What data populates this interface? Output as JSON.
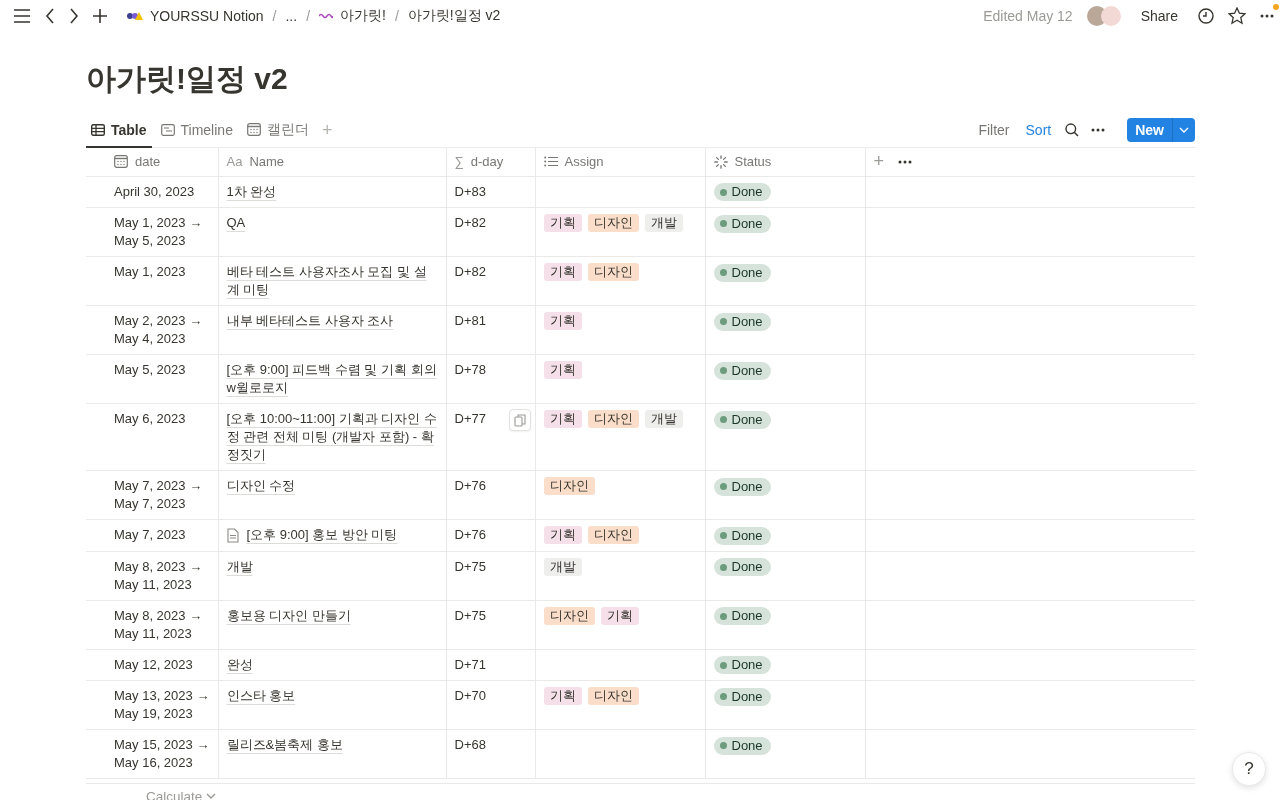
{
  "breadcrumbs": [
    {
      "kind": "link",
      "label": "YOURSSU Notion"
    },
    {
      "kind": "sep",
      "label": "/"
    },
    {
      "kind": "link",
      "label": "..."
    },
    {
      "kind": "sep",
      "label": "/"
    },
    {
      "kind": "link",
      "label": "아가릿!"
    },
    {
      "kind": "sep",
      "label": "/"
    },
    {
      "kind": "link",
      "label": "아가릿!일정 v2"
    }
  ],
  "edited": "Edited May 12",
  "share": "Share",
  "has_notification": true,
  "title": "아가릿!일정 v2",
  "views": [
    {
      "label": "Table",
      "selected": true
    },
    {
      "label": "Timeline",
      "selected": false
    },
    {
      "label": "캘린더",
      "selected": false
    }
  ],
  "add_view": "+",
  "toolbar": [
    {
      "label": "Filter",
      "active": false
    },
    {
      "label": "Sort",
      "active": true
    }
  ],
  "new_button": "New",
  "columns": [
    {
      "label": "date"
    },
    {
      "label": "Name",
      "glyph": "Aa"
    },
    {
      "label": "d-day",
      "glyph": "∑"
    },
    {
      "label": "Assign"
    },
    {
      "label": "Status"
    }
  ],
  "add_column": "+",
  "rows": [
    {
      "date": [
        "April 30, 2023"
      ],
      "name": "1차 완성",
      "page_icon": false,
      "dday": "D+83",
      "copy_button": false,
      "assign": [],
      "status": {
        "label": "Done",
        "color": "#6c9b7d"
      }
    },
    {
      "date": [
        "May 1, 2023 →",
        "May 5, 2023"
      ],
      "name": "QA",
      "page_icon": false,
      "dday": "D+82",
      "copy_button": false,
      "assign": [
        {
          "label": "기획",
          "color": "#f5e0e9"
        },
        {
          "label": "디자인",
          "color": "#fadec9"
        },
        {
          "label": "개발",
          "color": "#eeeeec"
        }
      ],
      "status": {
        "label": "Done",
        "color": "#6c9b7d"
      }
    },
    {
      "date": [
        "May 1, 2023"
      ],
      "name": "베타 테스트 사용자조사 모집 및 설계 미팅",
      "page_icon": false,
      "dday": "D+82",
      "copy_button": false,
      "assign": [
        {
          "label": "기획",
          "color": "#f5e0e9"
        },
        {
          "label": "디자인",
          "color": "#fadec9"
        }
      ],
      "status": {
        "label": "Done",
        "color": "#6c9b7d"
      }
    },
    {
      "date": [
        "May 2, 2023 →",
        "May 4, 2023"
      ],
      "name": "내부 베타테스트 사용자 조사",
      "page_icon": false,
      "dday": "D+81",
      "copy_button": false,
      "assign": [
        {
          "label": "기획",
          "color": "#f5e0e9"
        }
      ],
      "status": {
        "label": "Done",
        "color": "#6c9b7d"
      }
    },
    {
      "date": [
        "May 5, 2023"
      ],
      "name": "[오후 9:00] 피드백 수렴 및 기획 회의 w윌로로지",
      "page_icon": false,
      "dday": "D+78",
      "copy_button": false,
      "assign": [
        {
          "label": "기획",
          "color": "#f5e0e9"
        }
      ],
      "status": {
        "label": "Done",
        "color": "#6c9b7d"
      }
    },
    {
      "date": [
        "May 6, 2023"
      ],
      "name": "[오후 10:00~11:00] 기획과 디자인 수정 관련 전체 미팅 (개발자 포함) - 확정짓기",
      "page_icon": false,
      "dday": "D+77",
      "copy_button": true,
      "assign": [
        {
          "label": "기획",
          "color": "#f5e0e9"
        },
        {
          "label": "디자인",
          "color": "#fadec9"
        },
        {
          "label": "개발",
          "color": "#eeeeec"
        }
      ],
      "status": {
        "label": "Done",
        "color": "#6c9b7d"
      }
    },
    {
      "date": [
        "May 7, 2023 →",
        "May 7, 2023"
      ],
      "name": "디자인 수정",
      "page_icon": false,
      "dday": "D+76",
      "copy_button": false,
      "assign": [
        {
          "label": "디자인",
          "color": "#fadec9"
        }
      ],
      "status": {
        "label": "Done",
        "color": "#6c9b7d"
      }
    },
    {
      "date": [
        "May 7, 2023"
      ],
      "name": "[오후 9:00] 홍보 방안 미팅",
      "page_icon": true,
      "dday": "D+76",
      "copy_button": false,
      "assign": [
        {
          "label": "기획",
          "color": "#f5e0e9"
        },
        {
          "label": "디자인",
          "color": "#fadec9"
        }
      ],
      "status": {
        "label": "Done",
        "color": "#6c9b7d"
      }
    },
    {
      "date": [
        "May 8, 2023 →",
        "May 11, 2023"
      ],
      "name": "개발",
      "page_icon": false,
      "dday": "D+75",
      "copy_button": false,
      "assign": [
        {
          "label": "개발",
          "color": "#eeeeec"
        }
      ],
      "status": {
        "label": "Done",
        "color": "#6c9b7d"
      }
    },
    {
      "date": [
        "May 8, 2023 →",
        "May 11, 2023"
      ],
      "name": "홍보용 디자인 만들기",
      "page_icon": false,
      "dday": "D+75",
      "copy_button": false,
      "assign": [
        {
          "label": "디자인",
          "color": "#fadec9"
        },
        {
          "label": "기획",
          "color": "#f5e0e9"
        }
      ],
      "status": {
        "label": "Done",
        "color": "#6c9b7d"
      }
    },
    {
      "date": [
        "May 12, 2023"
      ],
      "name": "완성",
      "page_icon": false,
      "dday": "D+71",
      "copy_button": false,
      "assign": [],
      "status": {
        "label": "Done",
        "color": "#6c9b7d"
      }
    },
    {
      "date": [
        "May 13, 2023 →",
        "May 19, 2023"
      ],
      "name": "인스타 홍보",
      "page_icon": false,
      "dday": "D+70",
      "copy_button": false,
      "assign": [
        {
          "label": "기획",
          "color": "#f5e0e9"
        },
        {
          "label": "디자인",
          "color": "#fadec9"
        }
      ],
      "status": {
        "label": "Done",
        "color": "#6c9b7d"
      }
    },
    {
      "date": [
        "May 15, 2023 →",
        "May 16, 2023"
      ],
      "name": "릴리즈&봄축제 홍보",
      "page_icon": false,
      "dday": "D+68",
      "copy_button": false,
      "assign": [],
      "status": {
        "label": "Done",
        "color": "#6c9b7d"
      }
    }
  ],
  "calculate": "Calculate",
  "help": "?"
}
